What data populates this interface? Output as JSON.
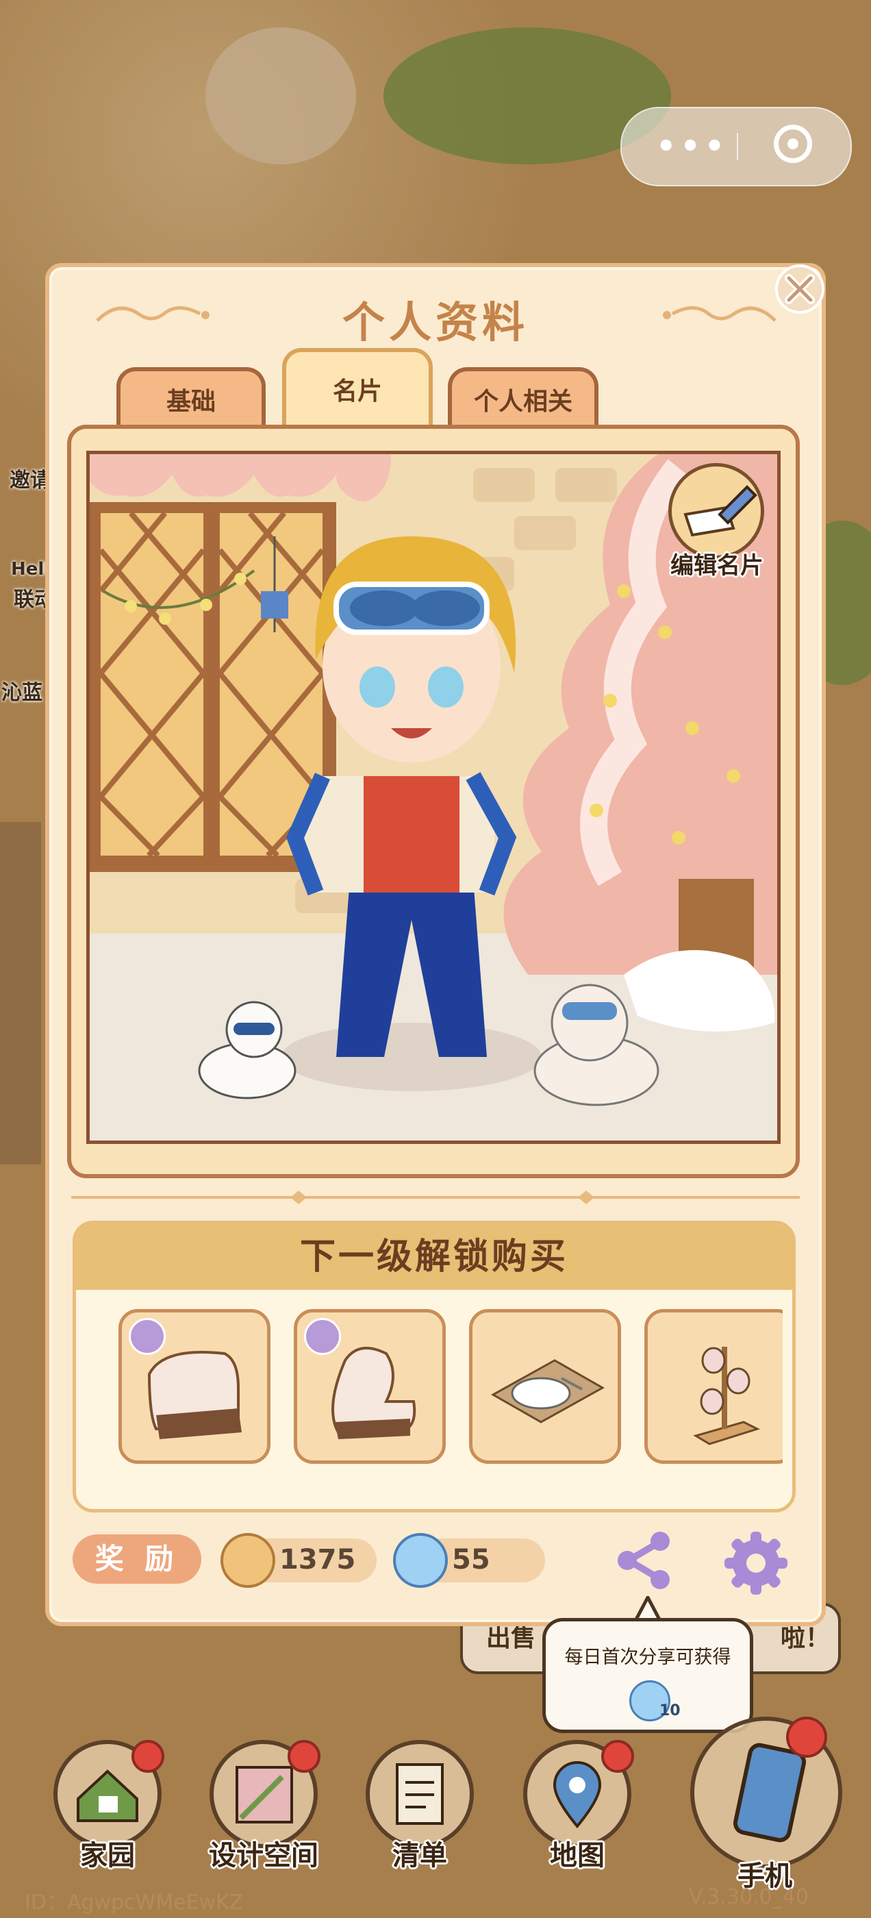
{
  "panel": {
    "title": "个人资料",
    "tabs": [
      {
        "label": "基础",
        "active": false
      },
      {
        "label": "名片",
        "active": true
      },
      {
        "label": "个人相关",
        "active": false
      }
    ],
    "edit_card_label": "编辑名片"
  },
  "unlock": {
    "title": "下一级解锁购买",
    "items": [
      {
        "icon": "armchair-icon",
        "badge": true
      },
      {
        "icon": "chair-icon",
        "badge": true
      },
      {
        "icon": "plate-placemat-icon",
        "badge": false
      },
      {
        "icon": "glass-rack-icon",
        "badge": false
      }
    ]
  },
  "bottom_bar": {
    "reward_label": "奖 励",
    "coin_value": "1375",
    "gem_value": "55"
  },
  "tooltip": {
    "text": "每日首次分享可获得",
    "amount": "10"
  },
  "background": {
    "side_labels": [
      "邀请",
      "Hell",
      "联动",
      "沁蓝"
    ],
    "bubble_left": "出售",
    "bubble_right": "啦！"
  },
  "nav": [
    {
      "label": "家园",
      "icon": "home-icon",
      "dot": true
    },
    {
      "label": "设计空间",
      "icon": "design-space-icon",
      "dot": true
    },
    {
      "label": "清单",
      "icon": "list-icon",
      "dot": false
    },
    {
      "label": "地图",
      "icon": "map-pin-icon",
      "dot": true
    },
    {
      "label": "手机",
      "icon": "phone-icon",
      "dot": true
    }
  ],
  "footer": {
    "id_text": "ID：AgwpcWMeEwKZ",
    "version": "V.3.30.0_40"
  },
  "colors": {
    "panel_bg": "#fbebd0",
    "title": "#c4834a",
    "tab_inactive": "#f4b987",
    "reward": "#eea77c",
    "share_icon": "#a98ad6",
    "alert_dot": "#e0453c"
  }
}
